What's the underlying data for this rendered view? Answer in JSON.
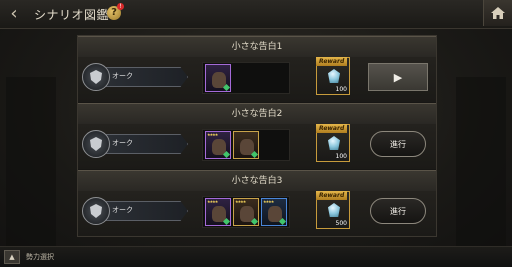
{
  "header": {
    "title": "シナリオ図鑑",
    "help_badge": "!"
  },
  "scenarios": [
    {
      "title": "小さな告白1",
      "faction_label": "オーク",
      "unit_count": 1,
      "reward_tag": "Reward",
      "reward_qty": "100",
      "action_type": "play",
      "action_label": "▶"
    },
    {
      "title": "小さな告白2",
      "faction_label": "オーク",
      "unit_count": 2,
      "reward_tag": "Reward",
      "reward_qty": "100",
      "action_type": "go",
      "action_label": "進行"
    },
    {
      "title": "小さな告白3",
      "faction_label": "オーク",
      "unit_count": 3,
      "reward_tag": "Reward",
      "reward_qty": "500",
      "action_type": "go",
      "action_label": "進行"
    }
  ],
  "footer": {
    "sort_icon": "▲",
    "sort_label": "勢力選択"
  },
  "colors": {
    "reward_gold": "#c79b3c",
    "unit_gold": "#c8a34a",
    "unit_purple": "#a46ad8",
    "unit_blue": "#4a86d8"
  }
}
